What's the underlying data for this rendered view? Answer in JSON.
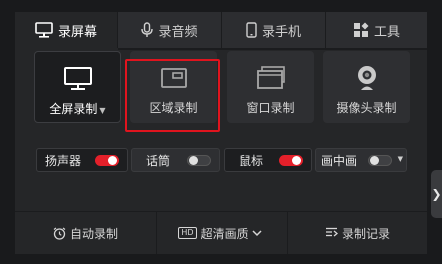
{
  "tabs": [
    {
      "label": "录屏幕",
      "icon": "monitor-icon",
      "active": true
    },
    {
      "label": "录音频",
      "icon": "microphone-icon",
      "active": false
    },
    {
      "label": "录手机",
      "icon": "phone-icon",
      "active": false
    },
    {
      "label": "工具",
      "icon": "toolbox-icon",
      "active": false
    }
  ],
  "modes": [
    {
      "label": "全屏录制",
      "icon": "monitor-icon",
      "selected": true,
      "has_dropdown": true
    },
    {
      "label": "区域录制",
      "icon": "region-icon",
      "selected": false
    },
    {
      "label": "窗口录制",
      "icon": "window-icon",
      "selected": false
    },
    {
      "label": "摄像头录制",
      "icon": "webcam-icon",
      "selected": false
    }
  ],
  "audio": [
    {
      "label": "扬声器",
      "on": true
    },
    {
      "label": "话筒",
      "on": false
    },
    {
      "label": "鼠标",
      "on": true
    },
    {
      "label": "画中画",
      "on": false,
      "has_dropdown": true
    }
  ],
  "bottom": {
    "auto_record": "自动录制",
    "quality_badge": "HD",
    "quality": "超清画质",
    "history": "录制记录"
  },
  "colors": {
    "accent": "#e4202a",
    "highlight_border": "#e0141e",
    "background": "#252628"
  }
}
